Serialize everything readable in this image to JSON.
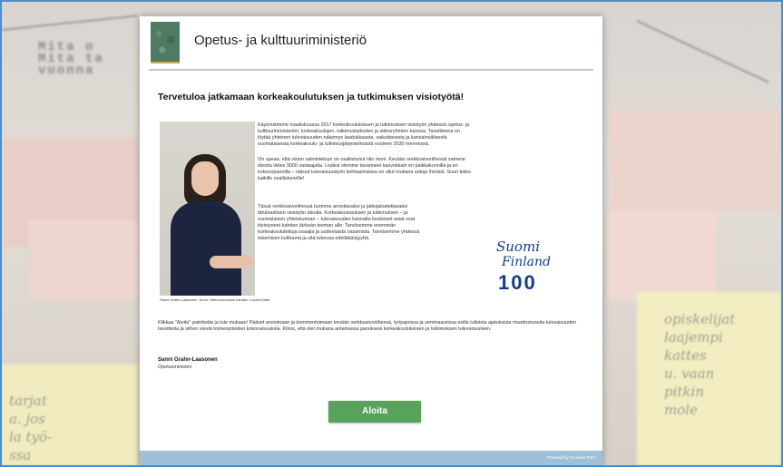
{
  "header": {
    "ministry": "Opetus- ja kulttuuriministeriö"
  },
  "logo_icon": "ministry-emblem",
  "welcome_title": "Tervetuloa jatkamaan korkeakoulutuksen ja tutkimuksen visiotyötä!",
  "photo_caption": "Sanni Grahn-Laasonen. Kuva: Valtioneuvoston kanslia / Laura Kotila",
  "paragraphs": [
    "Käynnistimme maaliskuussa 2017 korkeakoulutuksen ja tutkimuksen visiotyön yhdessä opetus- ja kulttuuriministeriön, korkeakoulujen, tutkimuslaitosten ja sidosryhmien kanssa. Tavoitteena on löytää yhteinen tulevaisuuden näkemys laadukkaasta, vaikuttavasta ja kansainvälisestä suomalaisesta korkeakoulu- ja tutkimusjärjestelmästä vuoteen 2030 mennessä.",
    "On upeaa, että vision valmisteluun on osallistunut niin moni. Kevään verkkoaivoriihessä saimme ideoita lähes 3000 vastaajalta. Lisäksi olemme tavanneet kasvokkain eri paikkakunnilla ja eri kokoonpanoilla – näissä tulevaisuustyön kohtaamisissa on ollut mukana satoja ihmisiä. Suuri kiitos kaikille osallistuneille!",
    "Tässä verkkoaivoriihessä tuomme arvioitavaksi ja jatkojalostettavaksi tähänastisen visiotyön ideoita. Korkeakoulutuksen ja tutkimuksen – ja suomalaisen yhteiskunnan – tulevaisuuden kannalta keskeiset asiat ovat tiivistyneet kahden tärkeän teeman alle: Tarvitsemme enemmän korkeakoulutettuja osaajia ja uudenlaista osaamista. Tarvitsemme yhdessä tekemisen kulttuuria ja sitä tukevaa edellä­kävijyyttä.",
    "Klikkaa \"Aloita\"-painiketta ja tule mukaan! Pääset arvioimaan ja kommentoimaan kevään verkkoaivoriihessä, työpajoissa ja seminaareissa esille tulleista ajatuksista muodostuneita tulevaisuuden tavoitteita ja siihen vieviä toimenpiteiden kokonaisuuksia. Kiitos, että olet mukana antamassa panoksesi korkeakoulutuksen ja tutkimuksen tulevaisuuteen."
  ],
  "signature": {
    "name": "Sanni Grahn-Laasonen",
    "title": "Opetusministeri"
  },
  "badge": {
    "line1": "Suomi",
    "line2": "Finland",
    "number": "100"
  },
  "start_button": "Aloita",
  "footer": {
    "powered": "Powered by Fountain Park"
  },
  "colors": {
    "button": "#58a25c",
    "footer": "#9ec0d8",
    "badge": "#123c8c",
    "frame": "#4a8fc9"
  }
}
